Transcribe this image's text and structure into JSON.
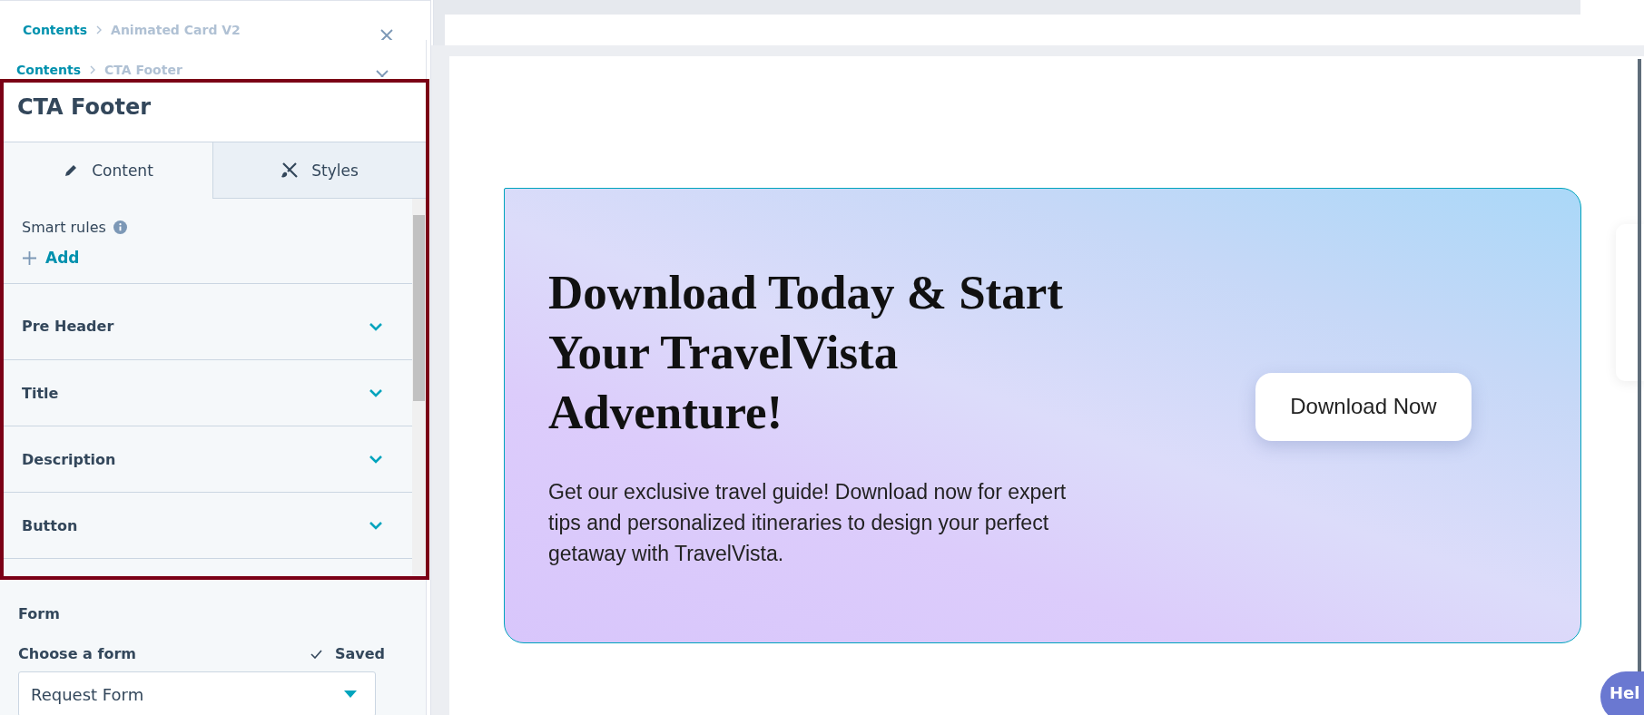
{
  "back_panel": {
    "breadcrumb": [
      {
        "label": "Contents",
        "kind": "link"
      },
      {
        "label": "Animated Card V2",
        "kind": "current"
      }
    ]
  },
  "panel": {
    "breadcrumb": [
      {
        "label": "Contents",
        "kind": "link"
      },
      {
        "label": "CTA Footer",
        "kind": "current"
      }
    ],
    "title": "CTA Footer",
    "tabs": [
      {
        "label": "Content",
        "selected": true
      },
      {
        "label": "Styles",
        "selected": false
      }
    ],
    "smart_rules": {
      "label": "Smart rules",
      "add": "Add"
    },
    "sections": [
      {
        "label": "Pre Header",
        "expanded": false
      },
      {
        "label": "Title",
        "expanded": false
      },
      {
        "label": "Description",
        "expanded": false
      },
      {
        "label": "Button",
        "expanded": false
      }
    ],
    "form": {
      "heading": "Form",
      "label": "Choose a form",
      "status": "Saved",
      "value": "Request Form"
    }
  },
  "preview": {
    "heading": "Download Today & Start Your TravelVista Adventure!",
    "description": "Get our exclusive travel guide! Download now for expert tips and personalized itineraries to design your perfect getaway with TravelVista.",
    "button": "Download Now"
  },
  "help_button": "Hel"
}
